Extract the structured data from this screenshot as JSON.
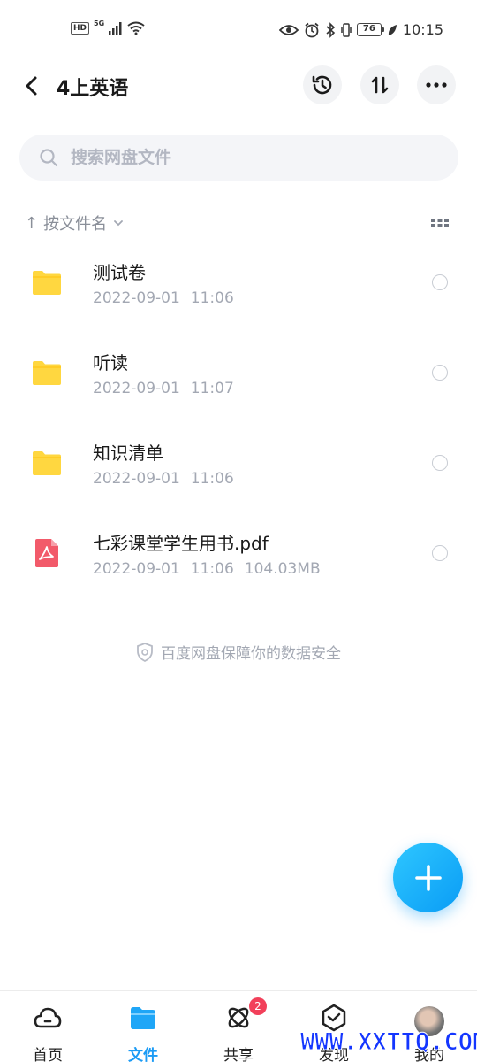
{
  "status_bar": {
    "left_hd": "HD",
    "left_5g": "5G",
    "battery": "76",
    "time": "10:15"
  },
  "header": {
    "title": "4上英语",
    "back_icon": "chevron-left-icon",
    "history_icon": "history-icon",
    "sort_icon": "sort-arrows-icon",
    "more_icon": "more-dots-icon"
  },
  "search": {
    "placeholder": "搜索网盘文件"
  },
  "sort": {
    "label": "按文件名",
    "arrow": "↑"
  },
  "files": [
    {
      "name": "测试卷",
      "date": "2022-09-01",
      "time": "11:06",
      "size": "",
      "type": "folder"
    },
    {
      "name": "听读",
      "date": "2022-09-01",
      "time": "11:07",
      "size": "",
      "type": "folder"
    },
    {
      "name": "知识清单",
      "date": "2022-09-01",
      "time": "11:06",
      "size": "",
      "type": "folder"
    },
    {
      "name": "七彩课堂学生用书.pdf",
      "date": "2022-09-01",
      "time": "11:06",
      "size": "104.03MB",
      "type": "pdf"
    }
  ],
  "safety_note": "百度网盘保障你的数据安全",
  "bottom_nav": {
    "items": [
      {
        "label": "首页",
        "icon": "cloud-icon"
      },
      {
        "label": "文件",
        "icon": "folder-icon"
      },
      {
        "label": "共享",
        "icon": "share-atom-icon"
      },
      {
        "label": "发现",
        "icon": "discover-icon"
      },
      {
        "label": "我的",
        "icon": "avatar"
      }
    ],
    "share_badge": "2"
  },
  "watermark": "WWW.XXTTQ.COM",
  "colors": {
    "accent": "#1b9bf5",
    "folder": "#ffd740",
    "pdf": "#f25a6a",
    "badge": "#f2405a"
  }
}
